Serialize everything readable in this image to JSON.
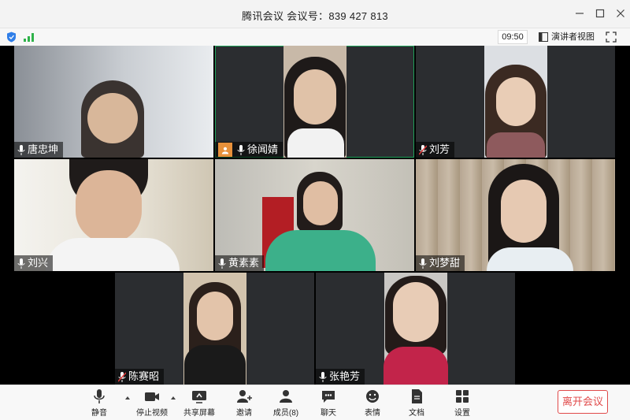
{
  "window": {
    "title": "腾讯会议 会议号：839 427 813"
  },
  "infobar": {
    "time": "09:50",
    "speaker_view_label": "演讲者视图"
  },
  "participants": [
    {
      "name": "唐忠坤",
      "mic": "on"
    },
    {
      "name": "徐闻婧",
      "mic": "on",
      "active": true
    },
    {
      "name": "刘芳",
      "mic": "muted"
    },
    {
      "name": "刘兴",
      "mic": "on"
    },
    {
      "name": "黄素素",
      "mic": "on"
    },
    {
      "name": "刘梦甜",
      "mic": "on"
    },
    {
      "name": "陈赛昭",
      "mic": "muted"
    },
    {
      "name": "张艳芳",
      "mic": "on"
    }
  ],
  "toolbar": {
    "mute": "静音",
    "stop_video": "停止视频",
    "share_screen": "共享屏幕",
    "invite": "邀请",
    "members": "成员(8)",
    "chat": "聊天",
    "emoji": "表情",
    "docs": "文档",
    "settings": "设置",
    "leave": "离开会议"
  },
  "colors": {
    "accent_green": "#1fa15a",
    "leave_red": "#e04a4a",
    "avatar_orange": "#e8913a"
  }
}
